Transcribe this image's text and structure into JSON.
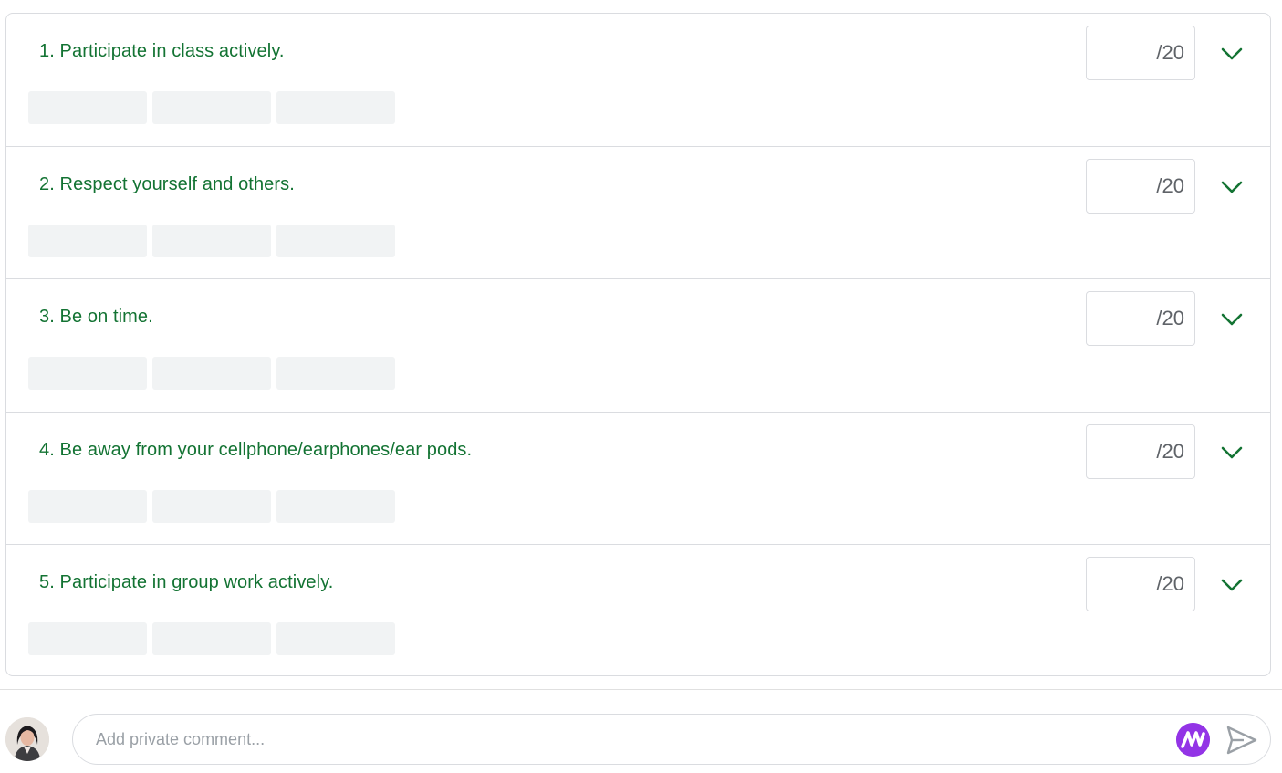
{
  "rubric": {
    "criteria": [
      {
        "title": "1. Participate in class actively.",
        "score_suffix": "/20"
      },
      {
        "title": "2. Respect yourself and others.",
        "score_suffix": "/20"
      },
      {
        "title": "3. Be on time.",
        "score_suffix": "/20"
      },
      {
        "title": "4. Be away from your cellphone/earphones/ear pods.",
        "score_suffix": "/20"
      },
      {
        "title": "5. Participate in group work actively.",
        "score_suffix": "/20"
      }
    ],
    "level_count": 3
  },
  "comment": {
    "placeholder": "Add private comment..."
  },
  "icons": {
    "expand": "chevron-down-icon",
    "extension": "extension-m-icon",
    "send": "send-icon"
  },
  "colors": {
    "criterion_title": "#137333",
    "extension_icon": "#9334e6"
  }
}
